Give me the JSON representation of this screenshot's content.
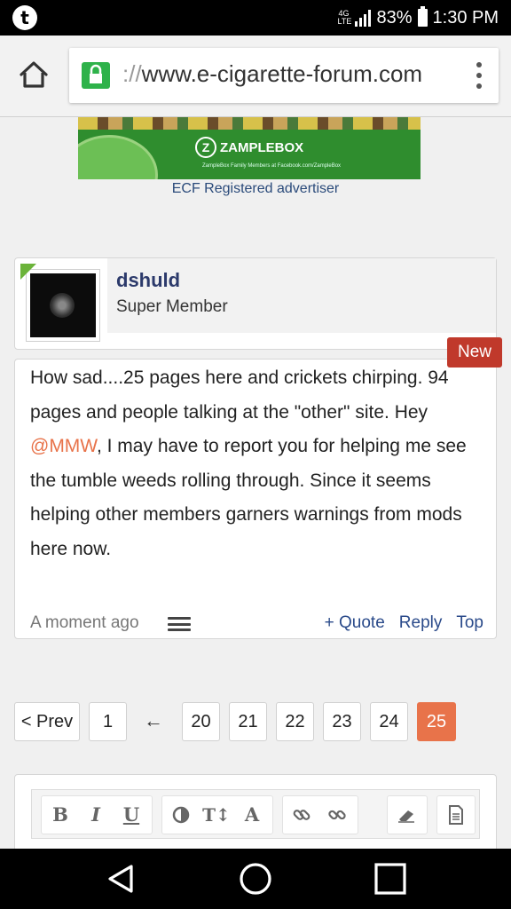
{
  "status_bar": {
    "app_icon": "t",
    "network": "4G LTE",
    "battery": "83%",
    "time": "1:30 PM"
  },
  "browser": {
    "url_scheme": "://",
    "url_host": "www.e-cigarette-forum.com"
  },
  "ad": {
    "brand": "ZAMPLEBOX",
    "fine_print": "ZampleBox Family Members at Facebook.com/ZampleBox",
    "caption": "ECF Registered advertiser"
  },
  "post": {
    "username": "dshuld",
    "user_title": "Super Member",
    "badge": "New",
    "message": {
      "before": "How sad....25 pages here and crickets chirping. 94 pages and people talking at the \"other\" site. Hey ",
      "mention": "@MMW",
      "after": ", I may have to report you for helping me see the tumble weeds rolling through. Since it seems helping other members garners warnings from mods here now."
    },
    "timestamp": "A moment ago",
    "actions": {
      "quote": "+ Quote",
      "reply": "Reply",
      "top": "Top"
    }
  },
  "pagination": {
    "prev": "< Prev",
    "first": "1",
    "arrow": "←",
    "pages": [
      "20",
      "21",
      "22",
      "23",
      "24",
      "25"
    ],
    "current": "25"
  },
  "editor": {
    "tools": [
      "B",
      "I",
      "U",
      "contrast-icon",
      "text-size-icon",
      "A",
      "link-icon",
      "unlink-icon",
      "eraser-icon",
      "document-icon"
    ]
  },
  "nav": {
    "icons": [
      "back-icon",
      "home-icon",
      "recents-icon"
    ]
  },
  "colors": {
    "accent": "#e8734a",
    "username": "#2c3a6b",
    "new_badge": "#c0392b",
    "lock": "#2eb24a"
  }
}
